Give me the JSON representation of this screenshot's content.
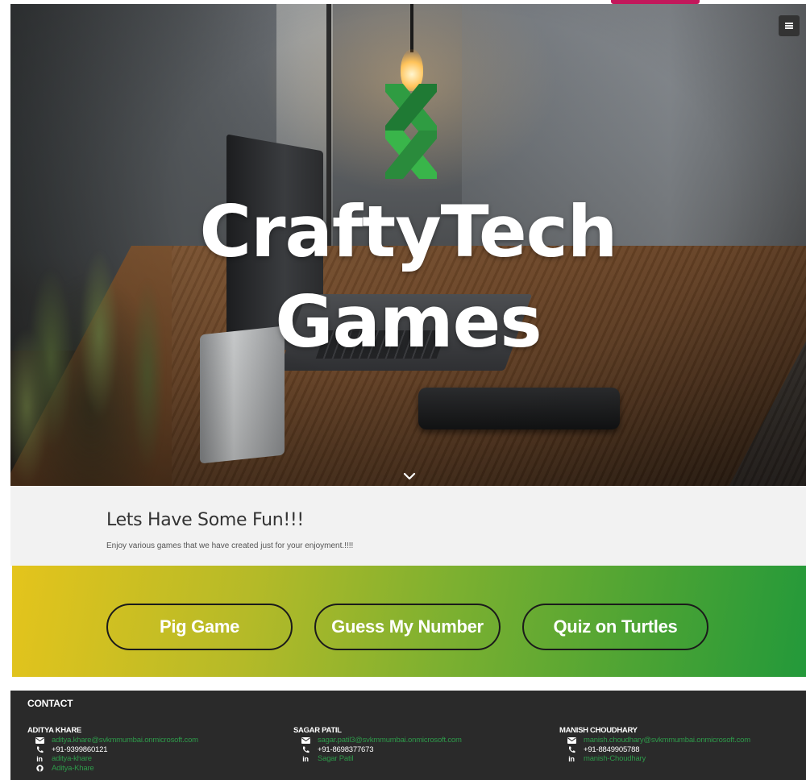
{
  "hero": {
    "title_line1": "CraftyTech",
    "title_line2": "Games"
  },
  "intro": {
    "heading": "Lets Have Some Fun!!!",
    "text": "Enjoy various games that we have created just for your enjoyment.!!!!"
  },
  "games": [
    {
      "label": "Pig Game"
    },
    {
      "label": "Guess My Number"
    },
    {
      "label": "Quiz on Turtles"
    }
  ],
  "footer": {
    "heading": "CONTACT",
    "contacts": [
      {
        "name": "ADITYA KHARE",
        "email": "aditya.khare@svkmmumbai.onmicrosoft.com",
        "phone": "+91-9399860121",
        "linkedin": "aditya-khare",
        "github": "Aditya-Khare"
      },
      {
        "name": "SAGAR PATIL",
        "email": "sagar.patil3@svkmmumbai.onmicrosoft.com",
        "phone": "+91-8698377673",
        "linkedin": "Sagar Patil"
      },
      {
        "name": "MANISH CHOUDHARY",
        "email": "manish.choudhary@svkmmumbai.onmicrosoft.com",
        "phone": "+91-8849905788",
        "linkedin": "manish-Choudhary"
      }
    ]
  },
  "icons": {
    "menu": "hamburger-icon",
    "scroll": "chevron-down-icon",
    "email": "envelope-icon",
    "phone": "phone-icon",
    "linkedin": "linkedin-icon",
    "github": "github-icon"
  },
  "colors": {
    "accent_tab": "#c2185b",
    "logo_green_dark": "#1f7a34",
    "logo_green_light": "#39b54a",
    "band_start": "#e4c41c",
    "band_end": "#23993a",
    "footer_bg": "#2a2a2a",
    "link_green": "#2e9a4a"
  }
}
